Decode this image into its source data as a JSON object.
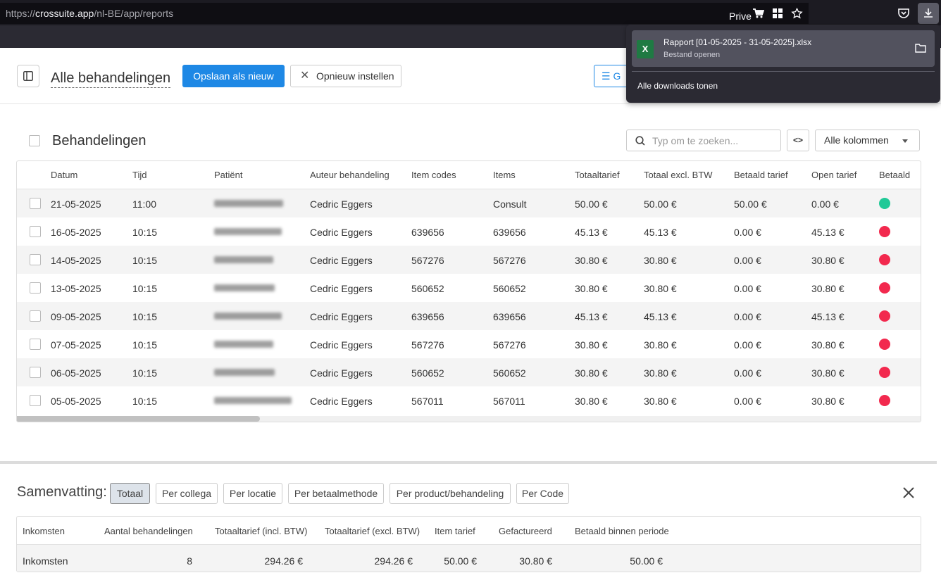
{
  "browser": {
    "url_prefix": "https://",
    "url_host": "crossuite.app",
    "url_path": "/nl-BE/app/reports",
    "private_label": "Prive"
  },
  "downloads": {
    "file_name": "Rapport [01-05-2025 - 31-05-2025].xlsx",
    "file_sub": "Bestand openen",
    "show_all": "Alle downloads tonen",
    "file_icon_letter": "X"
  },
  "header": {
    "title": "Alle behandelingen",
    "save_new": "Opslaan als nieuw",
    "reset": "Opnieuw instellen",
    "outline_btn": "G"
  },
  "section": {
    "title": "Behandelingen",
    "search_placeholder": "Typ om te zoeken...",
    "code_btn": "<>",
    "columns_select": "Alle kolommen"
  },
  "table": {
    "columns": [
      "Datum",
      "Tijd",
      "Patiënt",
      "Auteur behandeling",
      "Item codes",
      "Items",
      "Totaaltarief",
      "Totaal excl. BTW",
      "Betaald tarief",
      "Open tarief",
      "Betaald"
    ],
    "rows": [
      {
        "datum": "21-05-2025",
        "tijd": "11:00",
        "auteur": "Cedric Eggers",
        "item_codes": "",
        "items": "Consult",
        "totaal": "50.00 €",
        "excl": "50.00 €",
        "betaald_tarief": "50.00 €",
        "open": "0.00 €",
        "status": "paid"
      },
      {
        "datum": "16-05-2025",
        "tijd": "10:15",
        "auteur": "Cedric Eggers",
        "item_codes": "639656",
        "items": "639656",
        "totaal": "45.13 €",
        "excl": "45.13 €",
        "betaald_tarief": "0.00 €",
        "open": "45.13 €",
        "status": "unpaid"
      },
      {
        "datum": "14-05-2025",
        "tijd": "10:15",
        "auteur": "Cedric Eggers",
        "item_codes": "567276",
        "items": "567276",
        "totaal": "30.80 €",
        "excl": "30.80 €",
        "betaald_tarief": "0.00 €",
        "open": "30.80 €",
        "status": "unpaid"
      },
      {
        "datum": "13-05-2025",
        "tijd": "10:15",
        "auteur": "Cedric Eggers",
        "item_codes": "560652",
        "items": "560652",
        "totaal": "30.80 €",
        "excl": "30.80 €",
        "betaald_tarief": "0.00 €",
        "open": "30.80 €",
        "status": "unpaid"
      },
      {
        "datum": "09-05-2025",
        "tijd": "10:15",
        "auteur": "Cedric Eggers",
        "item_codes": "639656",
        "items": "639656",
        "totaal": "45.13 €",
        "excl": "45.13 €",
        "betaald_tarief": "0.00 €",
        "open": "45.13 €",
        "status": "unpaid"
      },
      {
        "datum": "07-05-2025",
        "tijd": "10:15",
        "auteur": "Cedric Eggers",
        "item_codes": "567276",
        "items": "567276",
        "totaal": "30.80 €",
        "excl": "30.80 €",
        "betaald_tarief": "0.00 €",
        "open": "30.80 €",
        "status": "unpaid"
      },
      {
        "datum": "06-05-2025",
        "tijd": "10:15",
        "auteur": "Cedric Eggers",
        "item_codes": "560652",
        "items": "560652",
        "totaal": "30.80 €",
        "excl": "30.80 €",
        "betaald_tarief": "0.00 €",
        "open": "30.80 €",
        "status": "unpaid"
      },
      {
        "datum": "05-05-2025",
        "tijd": "10:15",
        "auteur": "Cedric Eggers",
        "item_codes": "567011",
        "items": "567011",
        "totaal": "30.80 €",
        "excl": "30.80 €",
        "betaald_tarief": "0.00 €",
        "open": "30.80 €",
        "status": "unpaid"
      }
    ],
    "status_colors": {
      "paid": "#20c997",
      "unpaid": "#f2294e"
    }
  },
  "summary": {
    "title": "Samenvatting:",
    "tabs": [
      "Totaal",
      "Per collega",
      "Per locatie",
      "Per betaalmethode",
      "Per product/behandeling",
      "Per Code"
    ],
    "active_tab": "Totaal",
    "columns": [
      "Inkomsten",
      "Aantal behandelingen",
      "Totaaltarief (incl. BTW)",
      "Totaaltarief (excl. BTW)",
      "Item tarief",
      "Gefactureerd",
      "Betaald binnen periode"
    ],
    "row": [
      "Inkomsten",
      "8",
      "294.26 €",
      "294.26 €",
      "50.00 €",
      "30.80 €",
      "50.00 €"
    ]
  },
  "colors": {
    "accent": "#1e88e5",
    "chrome_dark": "#1c1b22"
  }
}
